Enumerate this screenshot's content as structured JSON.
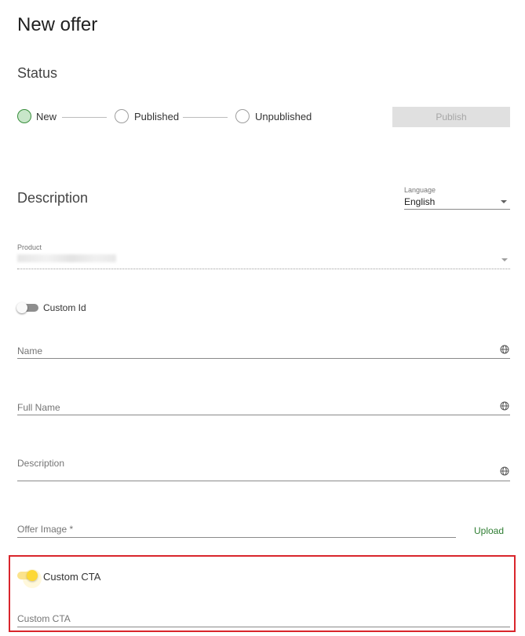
{
  "page": {
    "title": "New offer"
  },
  "status": {
    "heading": "Status",
    "steps": [
      {
        "label": "New",
        "active": true
      },
      {
        "label": "Published",
        "active": false
      },
      {
        "label": "Unpublished",
        "active": false
      }
    ],
    "publish_button": "Publish"
  },
  "description": {
    "heading": "Description",
    "language": {
      "label": "Language",
      "value": "English"
    },
    "product": {
      "label": "Product"
    },
    "custom_id_toggle": {
      "label": "Custom Id",
      "on": false
    },
    "fields": {
      "name": "Name",
      "full_name": "Full Name",
      "description": "Description",
      "offer_image": "Offer Image *"
    },
    "upload_button": "Upload",
    "custom_cta_toggle": {
      "label": "Custom CTA",
      "on": true
    },
    "custom_cta_field": "Custom CTA"
  },
  "colors": {
    "accent_green": "#2e7d32",
    "toggle_on": "#fdd835",
    "highlight_border": "#d9262c"
  },
  "icons": {
    "field_suffix": "globe-icon",
    "select_suffix": "caret-down-icon"
  }
}
